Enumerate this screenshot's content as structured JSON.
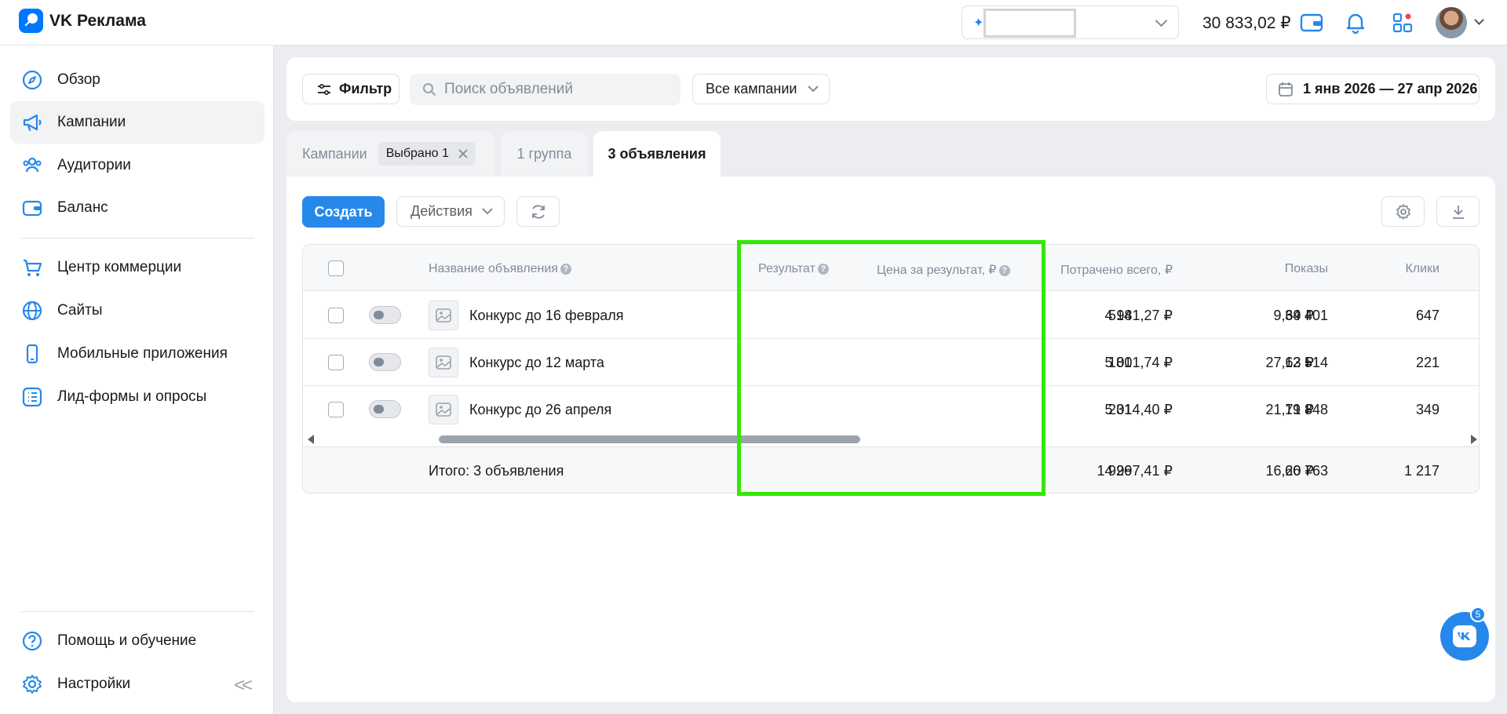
{
  "app": {
    "title": "VK Реклама"
  },
  "header": {
    "account_placeholder": "",
    "balance": "30 833,02 ₽",
    "icons": [
      "wallet-icon",
      "bell-icon",
      "apps-icon",
      "avatar"
    ]
  },
  "sidebar": {
    "items": [
      {
        "label": "Обзор",
        "icon": "compass-icon"
      },
      {
        "label": "Кампании",
        "icon": "megaphone-icon",
        "active": true
      },
      {
        "label": "Аудитории",
        "icon": "audience-icon"
      },
      {
        "label": "Баланс",
        "icon": "wallet-icon"
      },
      {
        "label": "Центр коммерции",
        "icon": "cart-icon"
      },
      {
        "label": "Сайты",
        "icon": "globe-icon"
      },
      {
        "label": "Мобильные приложения",
        "icon": "phone-icon"
      },
      {
        "label": "Лид-формы и опросы",
        "icon": "list-icon"
      }
    ],
    "bottom": [
      {
        "label": "Помощь и обучение",
        "icon": "help-icon"
      },
      {
        "label": "Настройки",
        "icon": "gear-icon"
      }
    ]
  },
  "filter": {
    "filter_label": "Фильтр",
    "search_placeholder": "Поиск объявлений",
    "campaigns_label": "Все кампании",
    "date_range": "1 янв 2026 — 27 апр 2026"
  },
  "tabs": {
    "campaigns": "Кампании",
    "selected_chip": "Выбрано 1",
    "groups": "1 группа",
    "ads": "3 объявления"
  },
  "toolbar": {
    "create_label": "Создать",
    "actions_label": "Действия"
  },
  "table": {
    "headers": {
      "name": "Название объявления",
      "result": "Результат",
      "price": "Цена за результат, ₽",
      "spent": "Потрачено всего, ₽",
      "impressions": "Показы",
      "clicks": "Клики"
    },
    "rows": [
      {
        "name": "Конкурс до 16 февраля",
        "result": "514",
        "price": "9,69 ₽",
        "spent": "4 981,27 ₽",
        "impressions": "34 401",
        "clicks": "647"
      },
      {
        "name": "Конкурс до 12 марта",
        "result": "181",
        "price": "27,63 ₽",
        "spent": "5 001,74 ₽",
        "impressions": "12 514",
        "clicks": "221"
      },
      {
        "name": "Конкурс до 26 апреля",
        "result": "231",
        "price": "21,71 ₽",
        "spent": "5 014,40 ₽",
        "impressions": "19 848",
        "clicks": "349"
      }
    ],
    "total": {
      "label": "Итого: 3 объявления",
      "result": "926",
      "price": "16,20 ₽",
      "spent": "14 997,41 ₽",
      "impressions": "66 763",
      "clicks": "1 217"
    }
  },
  "chat_badge": "5",
  "colors": {
    "accent": "#2688eb",
    "highlight": "#33e800"
  }
}
